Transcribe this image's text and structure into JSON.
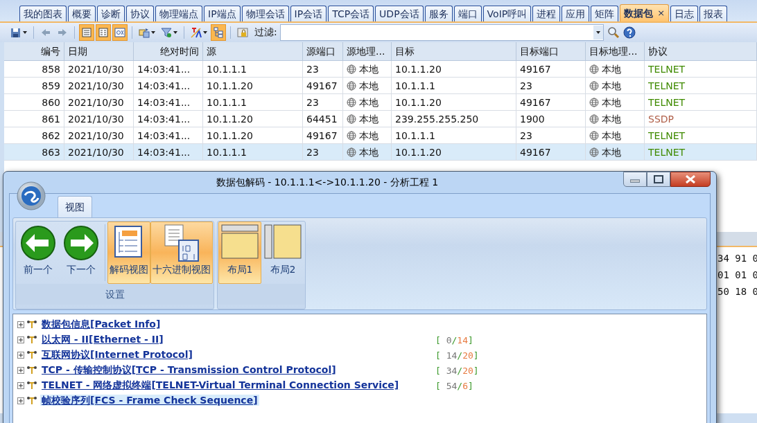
{
  "tabs": [
    {
      "label": "我的图表",
      "selected": false
    },
    {
      "label": "概要",
      "selected": false
    },
    {
      "label": "诊断",
      "selected": false
    },
    {
      "label": "协议",
      "selected": false
    },
    {
      "label": "物理端点",
      "selected": false
    },
    {
      "label": "IP端点",
      "selected": false
    },
    {
      "label": "物理会话",
      "selected": false
    },
    {
      "label": "IP会话",
      "selected": false
    },
    {
      "label": "TCP会话",
      "selected": false
    },
    {
      "label": "UDP会话",
      "selected": false
    },
    {
      "label": "服务",
      "selected": false
    },
    {
      "label": "端口",
      "selected": false
    },
    {
      "label": "VoIP呼叫",
      "selected": false
    },
    {
      "label": "进程",
      "selected": false
    },
    {
      "label": "应用",
      "selected": false
    },
    {
      "label": "矩阵",
      "selected": false
    },
    {
      "label": "数据包",
      "selected": true,
      "close": "×"
    },
    {
      "label": "日志",
      "selected": false
    },
    {
      "label": "报表",
      "selected": false
    }
  ],
  "toolbar": {
    "buttons": [
      {
        "kind": "save",
        "pressed": false,
        "dropdown": true
      },
      {
        "kind": "sep"
      },
      {
        "kind": "left",
        "pressed": false
      },
      {
        "kind": "right",
        "pressed": false
      },
      {
        "kind": "sep"
      },
      {
        "kind": "list",
        "pressed": true
      },
      {
        "kind": "detail",
        "pressed": true
      },
      {
        "kind": "hex",
        "pressed": true
      },
      {
        "kind": "sep"
      },
      {
        "kind": "swap",
        "pressed": false,
        "dropdown": true
      },
      {
        "kind": "filter",
        "pressed": false,
        "dropdown": true
      },
      {
        "kind": "sep"
      },
      {
        "kind": "font",
        "pressed": false,
        "dropdown": true
      },
      {
        "kind": "tree",
        "pressed": true
      },
      {
        "kind": "sep"
      },
      {
        "kind": "lock",
        "pressed": false
      }
    ],
    "filter_label": "过滤:"
  },
  "table": {
    "columns": [
      "编号",
      "日期",
      "绝对时间",
      "源",
      "源端口",
      "源地理...",
      "目标",
      "目标端口",
      "目标地理...",
      "协议"
    ],
    "rows": [
      {
        "cells": [
          "858",
          "2021/10/30",
          "14:03:41...",
          "10.1.1.1",
          "23",
          "本地",
          "10.1.1.20",
          "49167",
          "本地",
          "TELNET"
        ],
        "color": "#3f8a00",
        "selected": false
      },
      {
        "cells": [
          "859",
          "2021/10/30",
          "14:03:41...",
          "10.1.1.20",
          "49167",
          "本地",
          "10.1.1.1",
          "23",
          "本地",
          "TELNET"
        ],
        "color": "#3f8a00",
        "selected": false
      },
      {
        "cells": [
          "860",
          "2021/10/30",
          "14:03:41...",
          "10.1.1.1",
          "23",
          "本地",
          "10.1.1.20",
          "49167",
          "本地",
          "TELNET"
        ],
        "color": "#3f8a00",
        "selected": false
      },
      {
        "cells": [
          "861",
          "2021/10/30",
          "14:03:41...",
          "10.1.1.20",
          "64451",
          "本地",
          "239.255.255.250",
          "1900",
          "本地",
          "SSDP"
        ],
        "color": "#b0604a",
        "selected": false
      },
      {
        "cells": [
          "862",
          "2021/10/30",
          "14:03:41...",
          "10.1.1.20",
          "49167",
          "本地",
          "10.1.1.1",
          "23",
          "本地",
          "TELNET"
        ],
        "color": "#3f8a00",
        "selected": false
      },
      {
        "cells": [
          "863",
          "2021/10/30",
          "14:03:41...",
          "10.1.1.1",
          "23",
          "本地",
          "10.1.1.20",
          "49167",
          "本地",
          "TELNET"
        ],
        "color": "#3f8a00",
        "selected": true
      }
    ]
  },
  "hex_pane": {
    "lines": [
      "34 91 0",
      "01 01 0",
      "50 18 0"
    ]
  },
  "dialog": {
    "title": "数据包解码 - 10.1.1.1<->10.1.1.20 - 分析工程 1",
    "tab": "视图",
    "groups": [
      {
        "label": "设置",
        "buttons": [
          {
            "kind": "back",
            "label": "前一个",
            "pressed": false
          },
          {
            "kind": "forward",
            "label": "下一个",
            "pressed": false
          },
          {
            "kind": "sep"
          },
          {
            "kind": "decode",
            "label": "解码视图",
            "pressed": true
          },
          {
            "kind": "hexview",
            "label": "十六进制视图",
            "pressed": true
          }
        ]
      },
      {
        "buttons": [
          {
            "kind": "layout1",
            "label": "布局1",
            "pressed": true
          },
          {
            "kind": "layout2",
            "label": "布局2",
            "pressed": false
          }
        ]
      }
    ],
    "tree": [
      {
        "text": "数据包信息[Packet Info]",
        "selected": false
      },
      {
        "text": "以太网 - II[Ethernet - II]",
        "range": {
          "open": "[",
          "start": "0",
          "sep": "/",
          "length": "14",
          "close": "]"
        },
        "selected": false
      },
      {
        "text": "互联网协议[Internet Protocol]",
        "range": {
          "open": "[",
          "start": "14",
          "sep": "/",
          "length": "20",
          "close": "]"
        },
        "selected": false
      },
      {
        "text": "TCP - 传输控制协议[TCP - Transmission Control Protocol]",
        "range": {
          "open": "[",
          "start": "34",
          "sep": "/",
          "length": "20",
          "close": "]"
        },
        "selected": false
      },
      {
        "text": "TELNET - 网络虚拟终端[TELNET-Virtual Terminal Connection Service]",
        "range": {
          "open": "[",
          "start": "54",
          "sep": "/",
          "length": "6",
          "close": "]"
        },
        "selected": false
      },
      {
        "text": "帧校验序列[FCS - Frame Check Sequence]",
        "selected": true
      }
    ]
  }
}
